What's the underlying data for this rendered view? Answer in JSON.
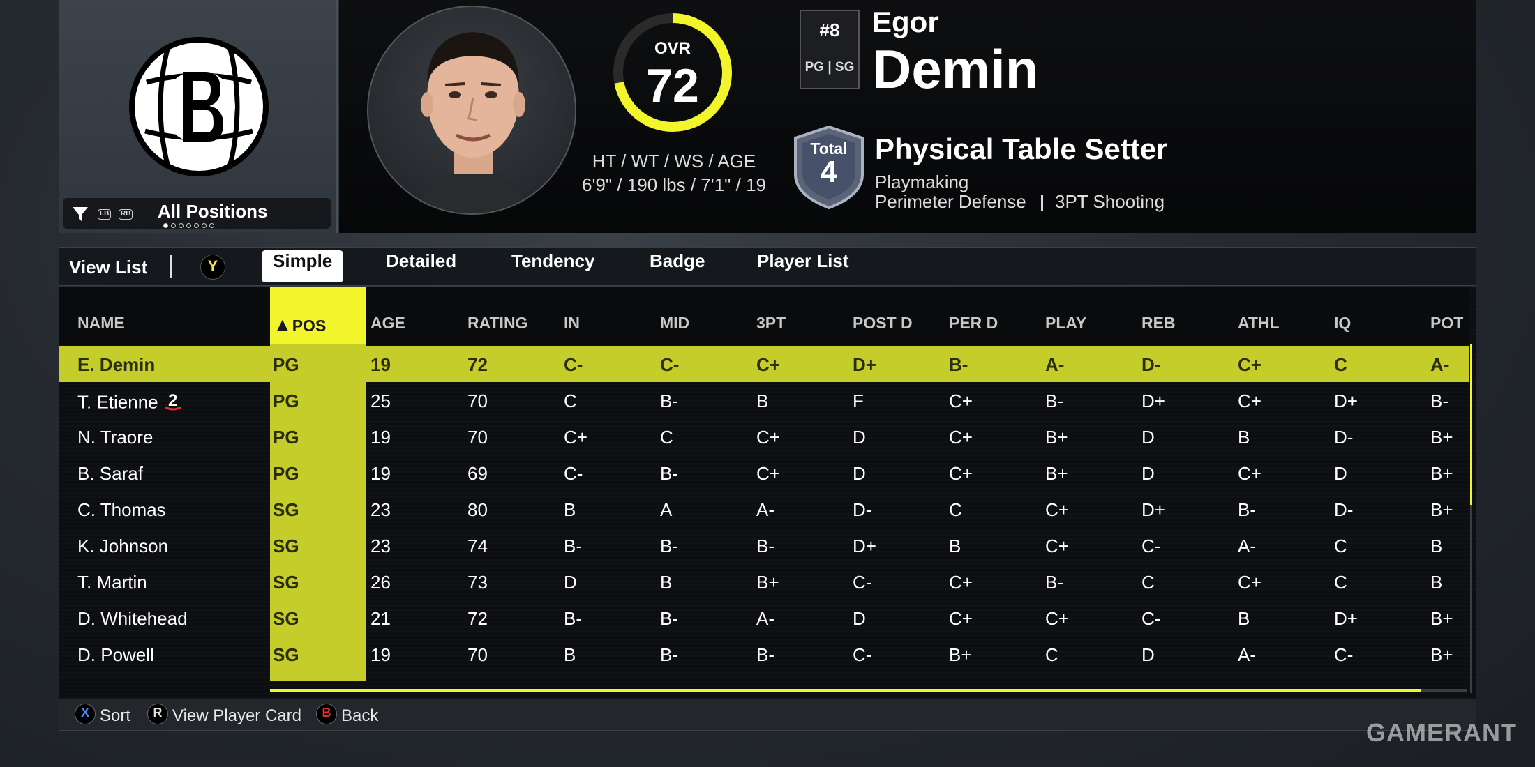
{
  "team": {
    "filter_label": "All Positions",
    "lb": "LB",
    "rb": "RB"
  },
  "player": {
    "ovr_label": "OVR",
    "ovr": "72",
    "ovr_fraction": 0.72,
    "bio_label": "HT / WT / WS / AGE",
    "bio_value": "6'9\" / 190 lbs / 7'1\" / 19",
    "jersey": "#8",
    "positions": "PG | SG",
    "first_name": "Egor",
    "last_name": "Demin",
    "total_label": "Total",
    "total": "4",
    "archetype": "Physical Table Setter",
    "skill_1": "Playmaking",
    "skill_2": "Perimeter Defense",
    "skill_3": "3PT Shooting"
  },
  "tabs": {
    "view_list": "View List",
    "y_button": "Y",
    "items": [
      "Simple",
      "Detailed",
      "Tendency",
      "Badge",
      "Player List"
    ],
    "active": 0
  },
  "table": {
    "sort_arrow": "▲",
    "columns": [
      "NAME",
      "POS",
      "AGE",
      "RATING",
      "IN",
      "MID",
      "3PT",
      "POST D",
      "PER D",
      "PLAY",
      "REB",
      "ATHL",
      "IQ",
      "POT"
    ],
    "rows": [
      [
        "E. Demin",
        "PG",
        "19",
        "72",
        "C-",
        "C-",
        "C+",
        "D+",
        "B-",
        "A-",
        "D-",
        "C+",
        "C",
        "A-"
      ],
      [
        "T. Etienne",
        "PG",
        "25",
        "70",
        "C",
        "B-",
        "B",
        "F",
        "C+",
        "B-",
        "D+",
        "C+",
        "D+",
        "B-"
      ],
      [
        "N. Traore",
        "PG",
        "19",
        "70",
        "C+",
        "C",
        "C+",
        "D",
        "C+",
        "B+",
        "D",
        "B",
        "D-",
        "B+"
      ],
      [
        "B. Saraf",
        "PG",
        "19",
        "69",
        "C-",
        "B-",
        "C+",
        "D",
        "C+",
        "B+",
        "D",
        "C+",
        "D",
        "B+"
      ],
      [
        "C. Thomas",
        "SG",
        "23",
        "80",
        "B",
        "A",
        "A-",
        "D-",
        "C",
        "C+",
        "D+",
        "B-",
        "D-",
        "B+"
      ],
      [
        "K. Johnson",
        "SG",
        "23",
        "74",
        "B-",
        "B-",
        "B-",
        "D+",
        "B",
        "C+",
        "C-",
        "A-",
        "C",
        "B"
      ],
      [
        "T. Martin",
        "SG",
        "26",
        "73",
        "D",
        "B",
        "B+",
        "C-",
        "C+",
        "B-",
        "C",
        "C+",
        "C",
        "B"
      ],
      [
        "D. Whitehead",
        "SG",
        "21",
        "72",
        "B-",
        "B-",
        "A-",
        "D",
        "C+",
        "C+",
        "C-",
        "B",
        "D+",
        "B+"
      ],
      [
        "D. Powell",
        "SG",
        "19",
        "70",
        "B",
        "B-",
        "B-",
        "C-",
        "B+",
        "C",
        "D",
        "A-",
        "C-",
        "B+"
      ]
    ],
    "hot_badge_row": 1,
    "hot_badge_text": "2"
  },
  "footer": {
    "sort_glyph": "X",
    "sort": "Sort",
    "card_glyph": "R",
    "card": "View Player Card",
    "back_glyph": "B",
    "back": "Back"
  },
  "watermark": "GAMERANT",
  "colors": {
    "accent": "#f2f52b",
    "selected_row": "#c5cd2b",
    "x_button": "#4a8cff",
    "b_button": "#e0302a"
  }
}
